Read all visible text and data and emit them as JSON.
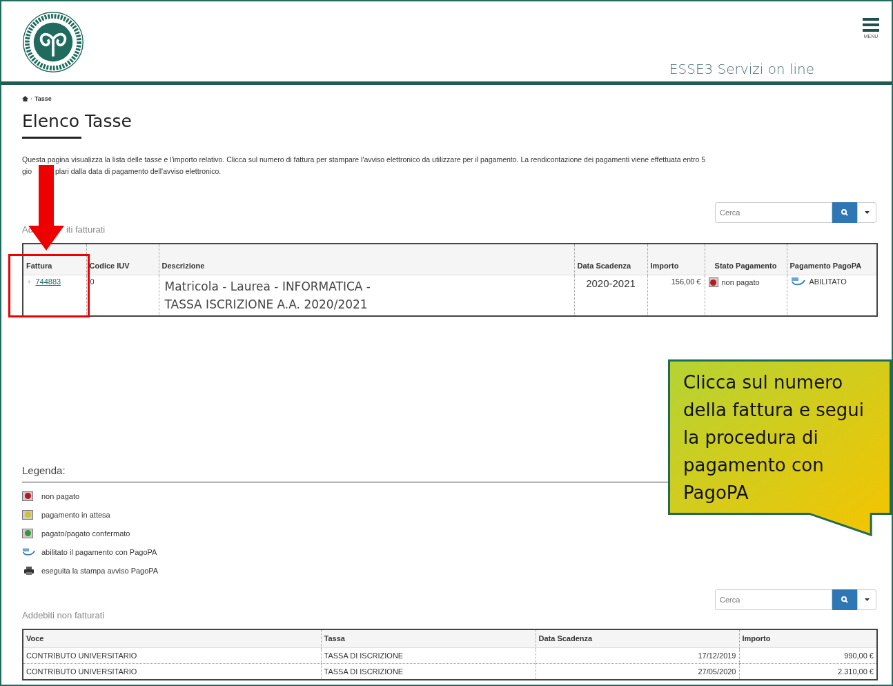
{
  "header": {
    "menu_label": "MENU",
    "site_title": "ESSE3 Servizi on line"
  },
  "breadcrumb": {
    "separator": "›",
    "current": "Tasse"
  },
  "page_title": "Elenco Tasse",
  "intro": {
    "line_1": "Questa pagina visualizza la lista delle tasse e l'importo relativo. Clicca sul numero di fattura per stampare l'avviso elettronico da utilizzare per il pagamento. La rendicontazione dei pagamenti viene effettuata entro 5",
    "line_2_before": "gio",
    "line_2_after": "plari dalla data di pagamento dell'avviso elettronico."
  },
  "billed": {
    "search": {
      "placeholder": "Cerca"
    },
    "label_before": "Ad",
    "label_after": "iti fatturati",
    "columns": [
      "Fattura",
      "Codice IUV",
      "Descrizione",
      "Data Scadenza",
      "Importo",
      "Stato Pagamento",
      "Pagamento PagoPA"
    ],
    "rows": [
      {
        "expand": "+",
        "fattura": "744883",
        "iuv": "0",
        "descrizione_1": "Matricola - Laurea - INFORMATICA -",
        "descrizione_2": "TASSA ISCRIZIONE A.A. 2020/2021",
        "scadenza": "2020-2021",
        "importo": "156,00 €",
        "stato": "non pagato",
        "color": "#b01c24",
        "pagopa": "ABILITATO"
      }
    ]
  },
  "legend": {
    "title": "Legenda:",
    "items": [
      {
        "kind": "status",
        "color": "#b01c24",
        "label": "non pagato"
      },
      {
        "kind": "status",
        "color": "#c9c23a",
        "label": "pagamento in attesa"
      },
      {
        "kind": "status",
        "color": "#2e9b3a",
        "label": "pagato/pagato confermato"
      },
      {
        "kind": "pagopa",
        "label": "abilitato il pagamento con PagoPA"
      },
      {
        "kind": "printer",
        "label": "eseguita la stampa avviso PagoPA"
      }
    ]
  },
  "unbilled": {
    "search": {
      "placeholder": "Cerca"
    },
    "label": "Addebiti non fatturati",
    "columns": [
      "Voce",
      "Tassa",
      "Data Scadenza",
      "Importo"
    ],
    "rows": [
      [
        "CONTRIBUTO UNIVERSITARIO",
        "TASSA DI ISCRIZIONE",
        "17/12/2019",
        "990,00 €"
      ],
      [
        "CONTRIBUTO UNIVERSITARIO",
        "TASSA DI ISCRIZIONE",
        "27/05/2020",
        "2.310,00 €"
      ]
    ]
  },
  "callout": {
    "text": "Clicca sul numero della fattura e segui la procedura di pagamento con PagoPA"
  }
}
